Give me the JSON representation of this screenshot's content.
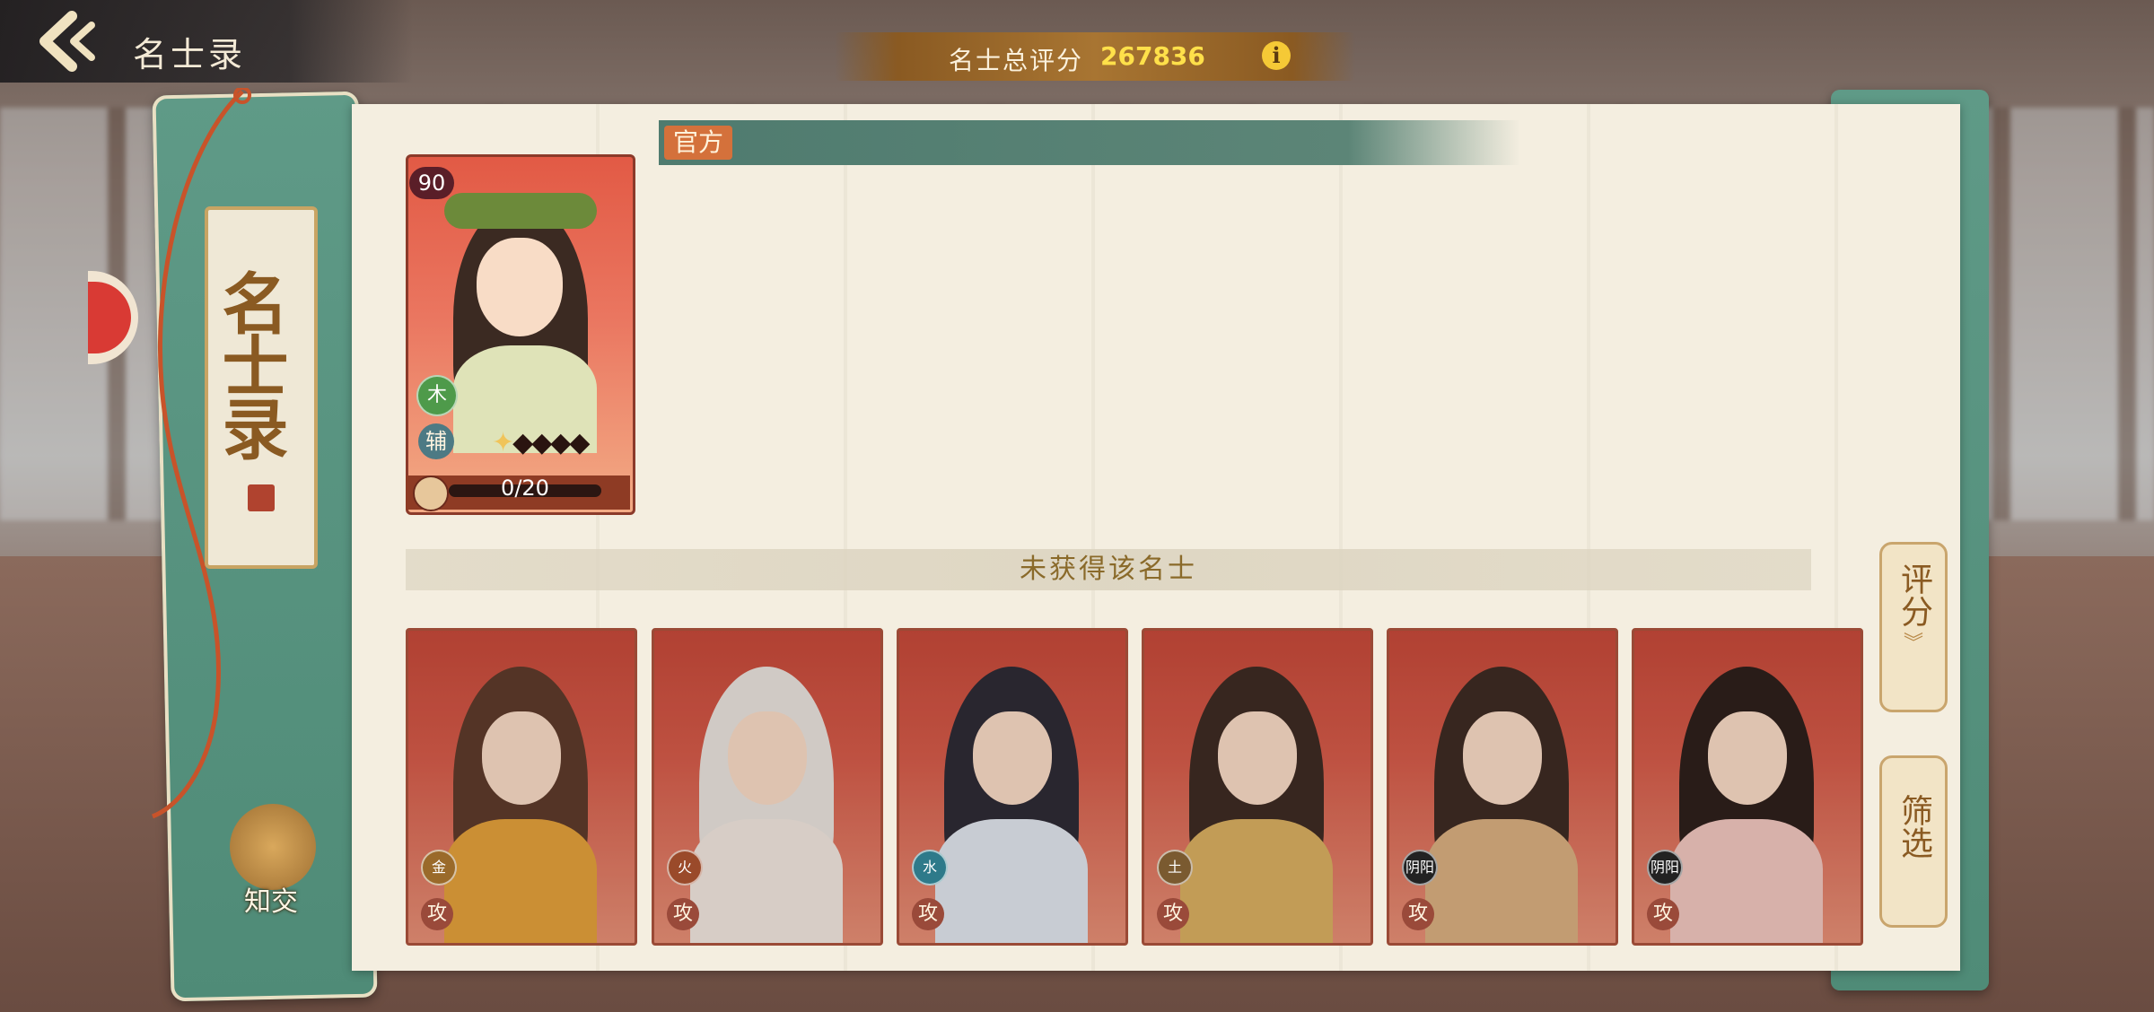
{
  "header": {
    "back_icon": "back-chevron-icon",
    "title": "名士录",
    "score_label": "名士总评分",
    "score_value": "267836",
    "info_icon_text": "i"
  },
  "sidebar": {
    "category_title": "名士录",
    "friend_label": "知交"
  },
  "section": {
    "tag": "官方",
    "unobtained_label": "未获得该名士"
  },
  "owned_card": {
    "level": "90",
    "element": "木",
    "role": "辅",
    "stars_filled": 1,
    "stars_total": 5,
    "progress_text": "0/20",
    "progress_fraction": 0
  },
  "locked_cards": [
    {
      "element": "金",
      "role": "攻",
      "element_color": "#9a6a2a"
    },
    {
      "element": "火",
      "role": "攻",
      "element_color": "#9a4a2a"
    },
    {
      "element": "水",
      "role": "攻",
      "element_color": "#2e7a8a"
    },
    {
      "element": "土",
      "role": "攻",
      "element_color": "#7a5a30"
    },
    {
      "element": "阴阳",
      "role": "攻",
      "element_color": "#222222"
    },
    {
      "element": "阴阳",
      "role": "攻",
      "element_color": "#222222"
    }
  ],
  "side_buttons": {
    "rating": "评分",
    "filter": "筛选"
  }
}
